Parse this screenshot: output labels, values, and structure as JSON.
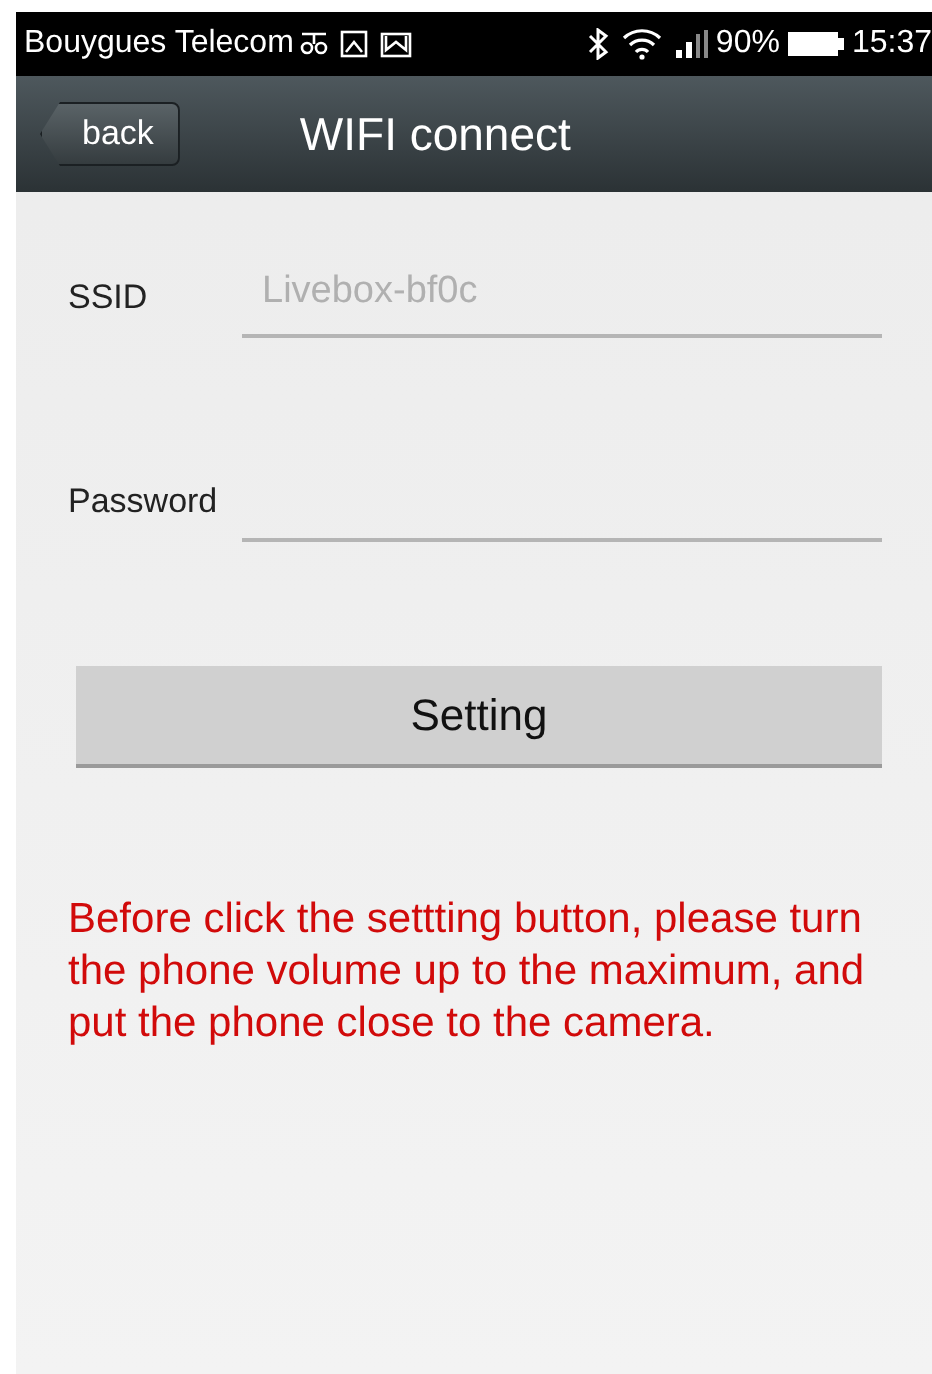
{
  "status_bar": {
    "carrier": "Bouygues Telecom",
    "battery_text": "90%",
    "time": "15:37"
  },
  "header": {
    "back": "back",
    "title": "WIFI connect"
  },
  "fields": [
    {
      "label": "SSID",
      "placeholder": "Livebox-bf0c"
    },
    {
      "label": "Password"
    }
  ],
  "button": "Setting",
  "notice": "Before click the settting button, please turn the phone volume up to the maximum, and put the phone close to the camera."
}
